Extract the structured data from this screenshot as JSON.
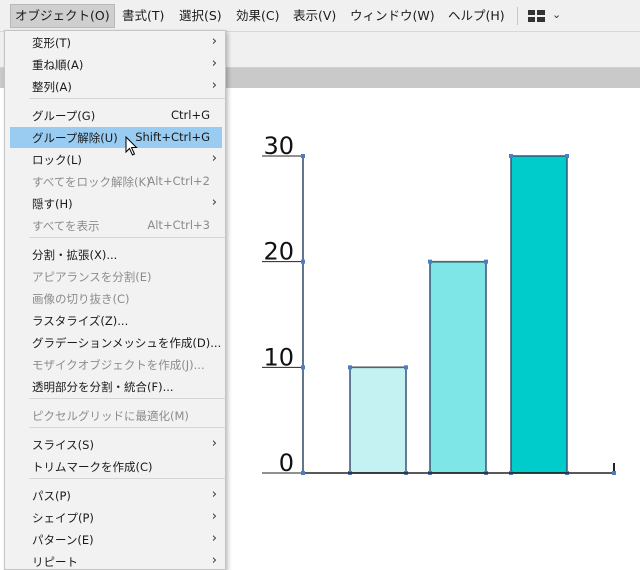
{
  "menubar": {
    "items": [
      "オブジェクト(O)",
      "書式(T)",
      "選択(S)",
      "効果(C)",
      "表示(V)",
      "ウィンドウ(W)",
      "ヘルプ(H)"
    ],
    "active_index": 0
  },
  "menu": {
    "items": [
      {
        "label": "変形(T)",
        "submenu": true
      },
      {
        "label": "重ね順(A)",
        "submenu": true
      },
      {
        "label": "整列(A)",
        "submenu": true
      },
      {
        "label": "グループ(G)",
        "shortcut": "Ctrl+G"
      },
      {
        "label": "グループ解除(U)",
        "shortcut": "Shift+Ctrl+G",
        "highlighted": true
      },
      {
        "label": "ロック(L)",
        "submenu": true
      },
      {
        "label": "すべてをロック解除(K)",
        "shortcut": "Alt+Ctrl+2",
        "disabled": true
      },
      {
        "label": "隠す(H)",
        "submenu": true
      },
      {
        "label": "すべてを表示",
        "shortcut": "Alt+Ctrl+3",
        "disabled": true
      },
      {
        "label": "分割・拡張(X)..."
      },
      {
        "label": "アピアランスを分割(E)",
        "disabled": true
      },
      {
        "label": "画像の切り抜き(C)",
        "disabled": true
      },
      {
        "label": "ラスタライズ(Z)..."
      },
      {
        "label": "グラデーションメッシュを作成(D)..."
      },
      {
        "label": "モザイクオブジェクトを作成(J)...",
        "disabled": true
      },
      {
        "label": "透明部分を分割・統合(F)..."
      },
      {
        "label": "ピクセルグリッドに最適化(M)",
        "disabled": true
      },
      {
        "label": "スライス(S)",
        "submenu": true
      },
      {
        "label": "トリムマークを作成(C)"
      },
      {
        "label": "パス(P)",
        "submenu": true
      },
      {
        "label": "シェイプ(P)",
        "submenu": true
      },
      {
        "label": "パターン(E)",
        "submenu": true
      },
      {
        "label": "リピート",
        "submenu": true
      }
    ]
  },
  "chart_data": {
    "type": "bar",
    "categories": [
      "",
      "",
      ""
    ],
    "values": [
      10,
      20,
      30
    ],
    "ticks": [
      "0",
      "10",
      "20",
      "30"
    ],
    "ylim": [
      0,
      30
    ],
    "colors": [
      "#c4f2f2",
      "#7ee6e6",
      "#00cccc"
    ],
    "selection_color": "#4a7fc6",
    "grid": false
  }
}
